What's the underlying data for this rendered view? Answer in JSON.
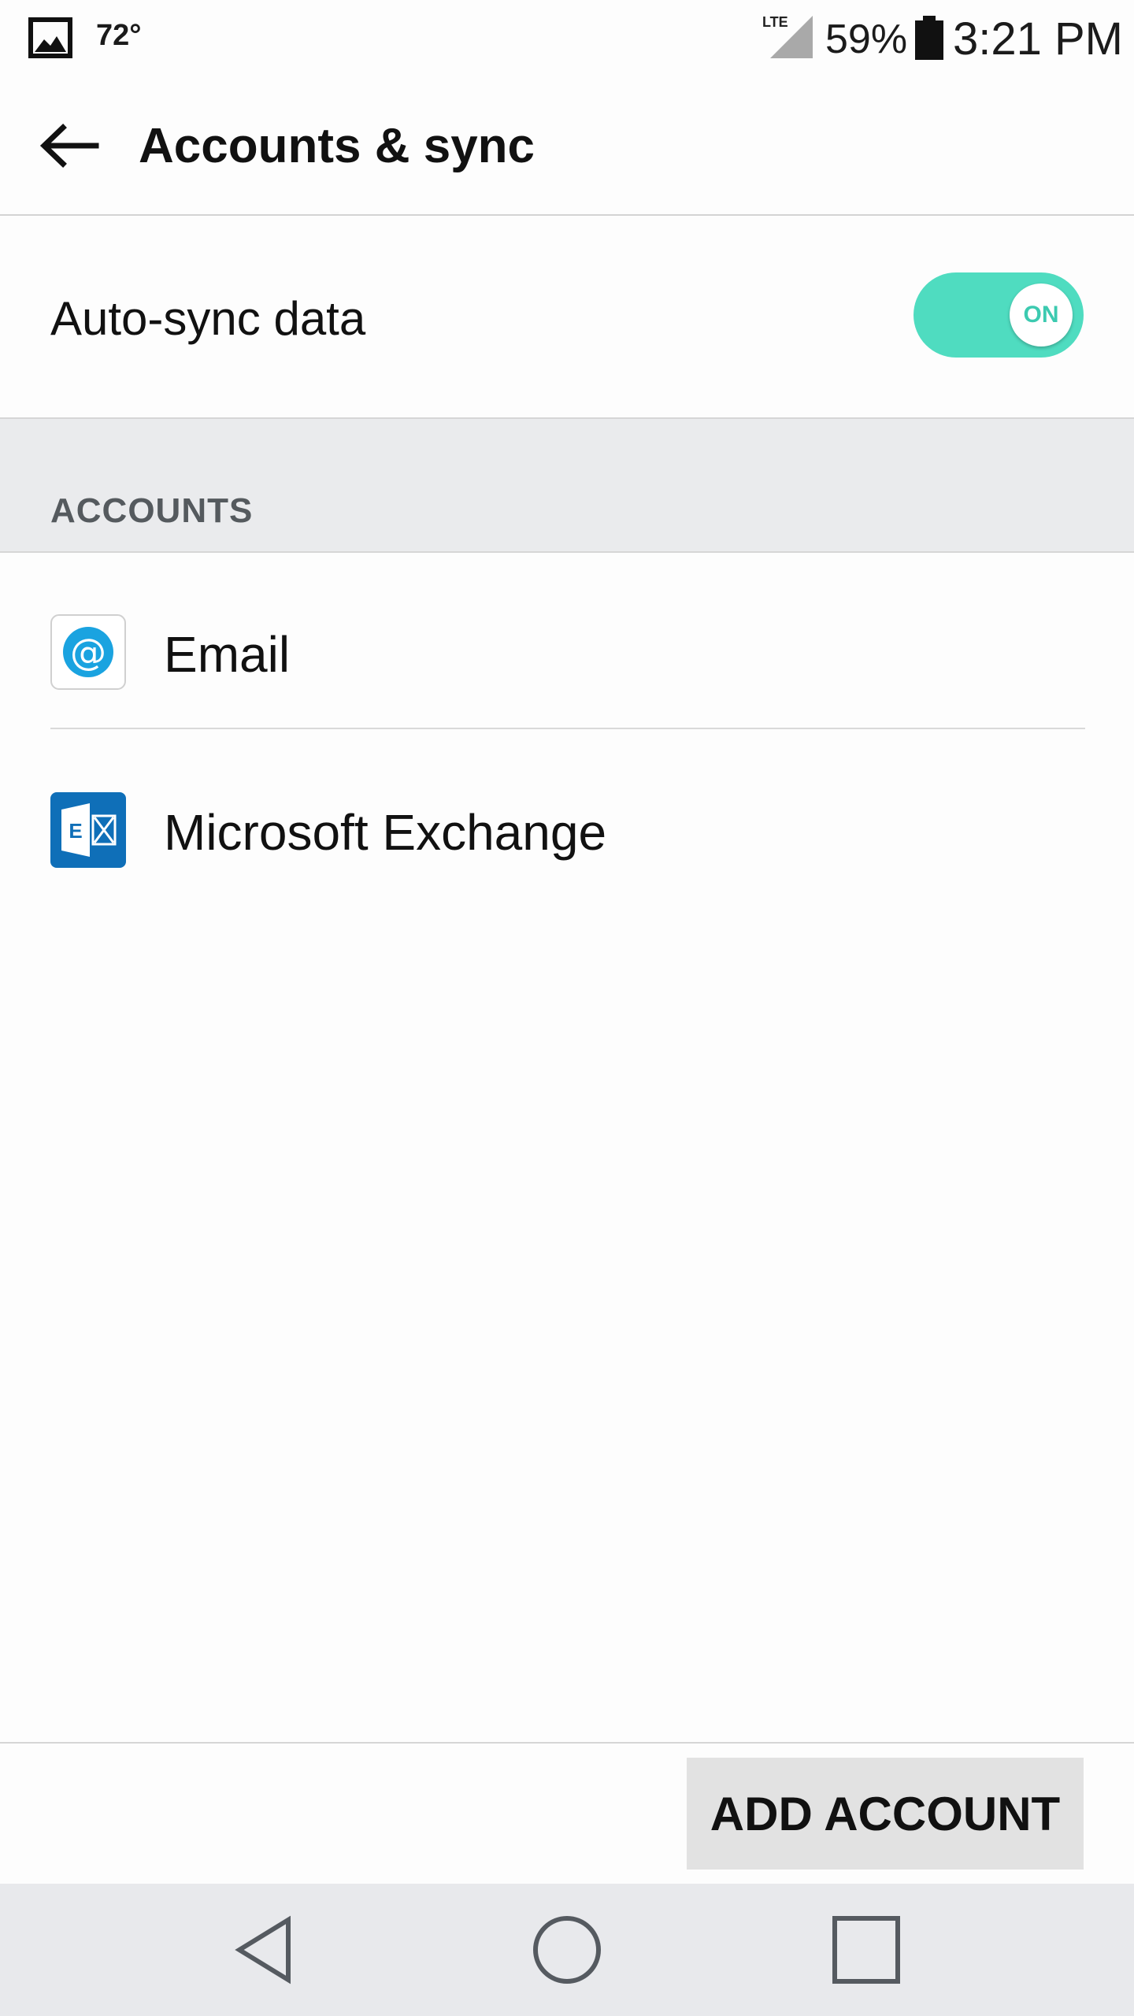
{
  "status_bar": {
    "temperature": "72°",
    "network": "LTE",
    "battery_percent": "59%",
    "time": "3:21 PM",
    "icons": [
      "gallery-icon",
      "signal-icon",
      "battery-icon"
    ]
  },
  "app_bar": {
    "title": "Accounts & sync",
    "back_icon": "arrow-left-icon"
  },
  "auto_sync": {
    "label": "Auto-sync data",
    "toggle_state": "ON",
    "toggle_color": "#4fdcc0"
  },
  "accounts_section": {
    "header": "ACCOUNTS",
    "items": [
      {
        "label": "Email",
        "icon": "email-at-icon",
        "icon_color": "#1aa3e0"
      },
      {
        "label": "Microsoft Exchange",
        "icon": "exchange-icon",
        "icon_color": "#0f6fb8"
      }
    ]
  },
  "actions": {
    "add_account": "ADD ACCOUNT"
  },
  "nav_bar": {
    "icons": [
      "nav-back-icon",
      "nav-home-icon",
      "nav-recents-icon"
    ]
  }
}
